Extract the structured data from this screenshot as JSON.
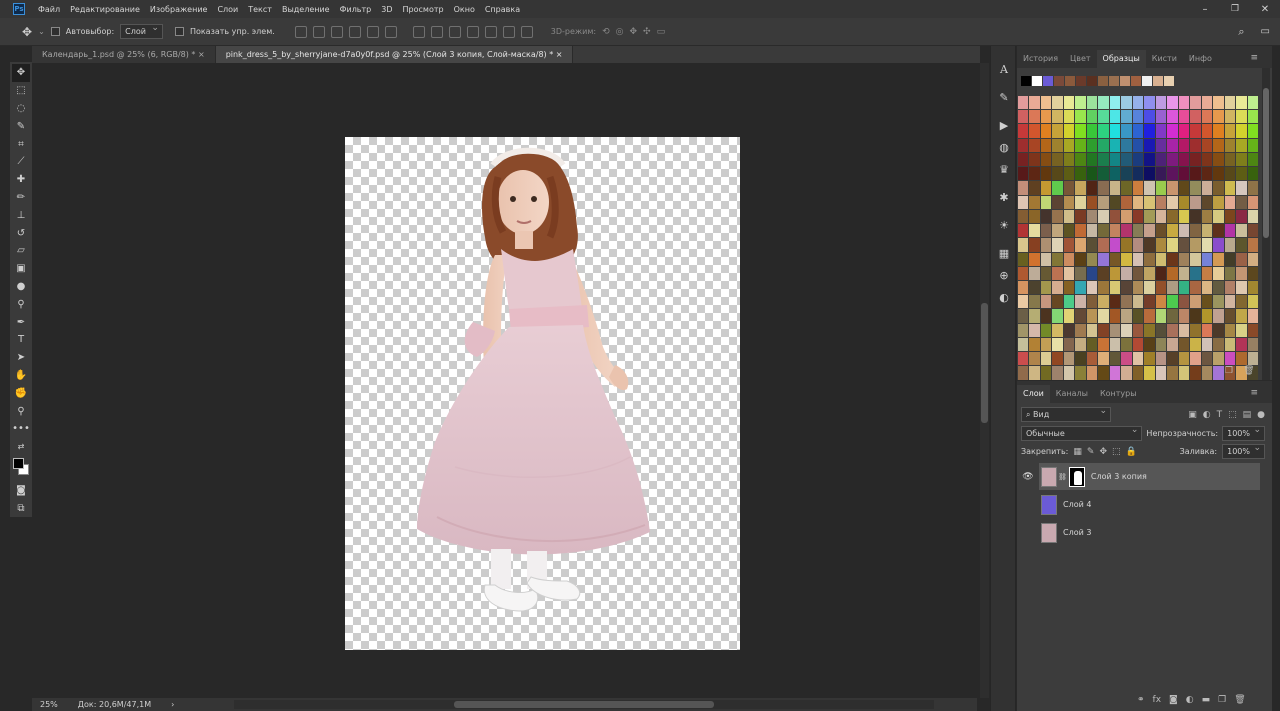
{
  "menu": {
    "items": [
      "Файл",
      "Редактирование",
      "Изображение",
      "Слои",
      "Текст",
      "Выделение",
      "Фильтр",
      "3D",
      "Просмотр",
      "Окно",
      "Справка"
    ]
  },
  "options": {
    "autoselect_label": "Автовыбор:",
    "autoselect_value": "Слой",
    "show_controls_label": "Показать упр. элем.",
    "mode3d_label": "3D-режим:"
  },
  "tabs": [
    {
      "label": "Календарь_1.psd @ 25% (6, RGB/8) *"
    },
    {
      "label": "pink_dress_5_by_sherryjane-d7a0y0f.psd @ 25% (Слой 3 копия, Слой-маска/8) *"
    }
  ],
  "tools": [
    "move",
    "marquee",
    "lasso",
    "quick-select",
    "crop",
    "eyedropper",
    "healing",
    "brush",
    "stamp",
    "history-brush",
    "eraser",
    "gradient",
    "blur",
    "dodge",
    "pen",
    "type",
    "path-select",
    "shape",
    "hand",
    "zoom",
    "more",
    "swap",
    "colors",
    "quickmask",
    "screenmode"
  ],
  "status": {
    "zoom": "25%",
    "doc": "Док: 20,6M/47,1M"
  },
  "swatches_panel": {
    "tabs": [
      "История",
      "Цвет",
      "Образцы",
      "Кисти",
      "Инфо"
    ],
    "active_tab": "Образцы",
    "recent": [
      "#000000",
      "#ffffff",
      "#6b5bd6",
      "#7a4a3a",
      "#8b5a3c",
      "#6a3a2a",
      "#5a3020",
      "#8a6040",
      "#9a7050",
      "#c09070",
      "#a06040",
      "#f0f0f0",
      "#d8b090",
      "#e8d0b0"
    ]
  },
  "layers_panel": {
    "tabs": [
      "Слои",
      "Каналы",
      "Контуры"
    ],
    "active_tab": "Слои",
    "kind_filter": "Вид",
    "blend_mode": "Обычные",
    "opacity_label": "Непрозрачность:",
    "opacity_value": "100%",
    "lock_label": "Закрепить:",
    "fill_label": "Заливка:",
    "fill_value": "100%",
    "layers": [
      {
        "name": "Слой 3 копия",
        "visible": true,
        "active": true,
        "has_mask": true,
        "thumb_color": "#c9a9b0"
      },
      {
        "name": "Слой 4",
        "visible": false,
        "active": false,
        "has_mask": false,
        "thumb_color": "#6b5bd6"
      },
      {
        "name": "Слой 3",
        "visible": false,
        "active": false,
        "has_mask": false,
        "thumb_color": "#c9a9b0"
      }
    ]
  },
  "colors": {
    "accent": "#3a8fd9",
    "foreground": "#000000",
    "background": "#ffffff"
  }
}
